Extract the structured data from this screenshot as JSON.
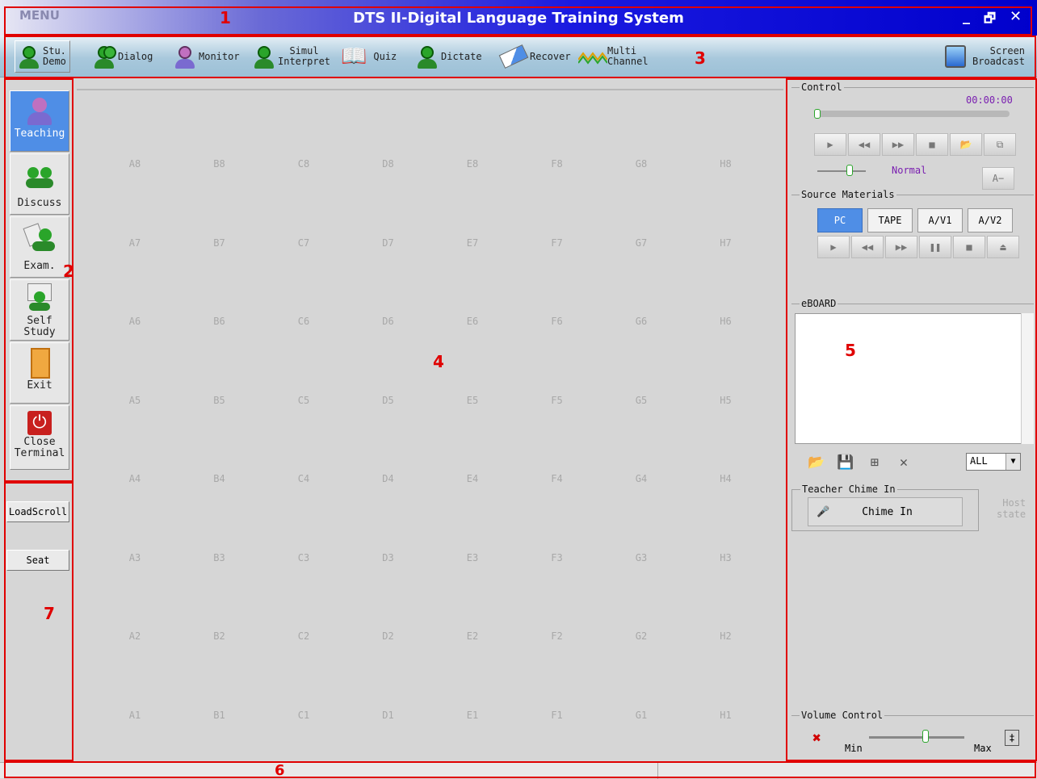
{
  "window": {
    "menu": "MENU",
    "title": "DTS II-Digital Language Training System",
    "minimize": "_",
    "restore": "🗗",
    "close": "✕"
  },
  "toolbar": {
    "items": [
      {
        "l1": "Stu.",
        "l2": "Demo",
        "icon": "student-head-icon"
      },
      {
        "l1": "Dialog",
        "l2": "",
        "icon": "dialog-heads-icon"
      },
      {
        "l1": "Monitor",
        "l2": "",
        "icon": "monitor-head-icon"
      },
      {
        "l1": "Simul",
        "l2": "Interpret",
        "icon": "interpret-head-icon"
      },
      {
        "l1": "Quiz",
        "l2": "",
        "icon": "quiz-book-icon"
      },
      {
        "l1": "Dictate",
        "l2": "",
        "icon": "dictate-head-icon"
      },
      {
        "l1": "Recover",
        "l2": "",
        "icon": "eraser-icon"
      },
      {
        "l1": "Multi",
        "l2": "Channel",
        "icon": "waveform-icon"
      }
    ],
    "broadcast": {
      "l1": "Screen",
      "l2": "Broadcast",
      "icon": "screen-broadcast-icon"
    }
  },
  "sidebar": {
    "modes": [
      {
        "label": "Teaching",
        "icon": "teacher-icon",
        "active": true
      },
      {
        "label": "Discuss",
        "icon": "discuss-group-icon"
      },
      {
        "label": "Exam.",
        "icon": "exam-icon"
      },
      {
        "l1": "Self",
        "l2": "Study",
        "icon": "self-study-icon"
      },
      {
        "label": "Exit",
        "icon": "door-exit-icon"
      },
      {
        "l1": "Close",
        "l2": "Terminal",
        "icon": "power-icon"
      }
    ],
    "load_scroll": "LoadScroll",
    "seat": "Seat"
  },
  "seats": {
    "cols": [
      "A",
      "B",
      "C",
      "D",
      "E",
      "F",
      "G",
      "H"
    ],
    "rows": [
      "8",
      "7",
      "6",
      "5",
      "4",
      "3",
      "2",
      "1"
    ]
  },
  "control": {
    "title": "Control",
    "time": "00:00:00",
    "speed": "Normal",
    "font_btn": "A−"
  },
  "source": {
    "title": "Source Materials",
    "buttons": [
      "PC",
      "TAPE",
      "A/V1",
      "A/V2"
    ],
    "selected": "PC"
  },
  "eboard": {
    "title": "eBOARD",
    "filter": "ALL"
  },
  "chime": {
    "title": "Teacher Chime In",
    "button": "Chime In",
    "host_l1": "Host",
    "host_l2": "state"
  },
  "volume": {
    "title": "Volume Control",
    "min": "Min",
    "max": "Max",
    "level": 0.6
  },
  "annotations": [
    "1",
    "2",
    "3",
    "4",
    "5",
    "6",
    "7"
  ],
  "colors": {
    "accent": "#4f8ee6",
    "annotation": "#e00000",
    "title_blue": "#0000cc",
    "time": "#7a1fb0"
  }
}
